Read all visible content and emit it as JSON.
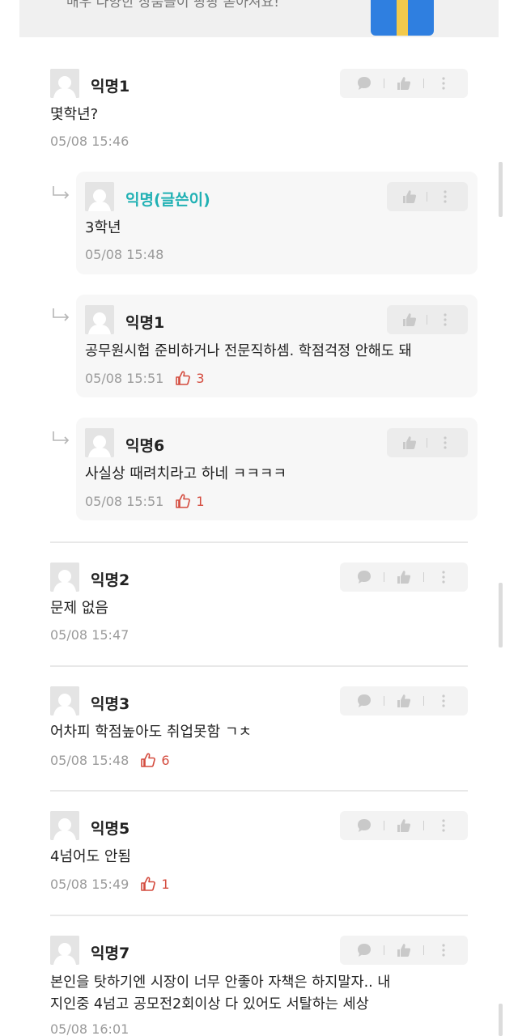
{
  "banner": {
    "text": "매우 다양한 상품들이 팡팡 쏟아져요!"
  },
  "comments": [
    {
      "author": "익명1",
      "body": "몇학년?",
      "time": "05/08 15:46",
      "likes": ""
    },
    {
      "author": "익명(글쓴이)",
      "body": "3학년",
      "time": "05/08 15:48",
      "likes": ""
    },
    {
      "author": "익명1",
      "body": "공무원시험 준비하거나 전문직하셈. 학점걱정 안해도 돼",
      "time": "05/08 15:51",
      "likes": "3"
    },
    {
      "author": "익명6",
      "body": "사실상 때려치라고 하네 ㅋㅋㅋㅋ",
      "time": "05/08 15:51",
      "likes": "1"
    },
    {
      "author": "익명2",
      "body": "문제 없음",
      "time": "05/08 15:47",
      "likes": ""
    },
    {
      "author": "익명3",
      "body": "어차피 학점높아도 취업못함 ㄱㅊ",
      "time": "05/08 15:48",
      "likes": "6"
    },
    {
      "author": "익명5",
      "body": "4넘어도 안됨",
      "time": "05/08 15:49",
      "likes": "1"
    },
    {
      "author": "익명7",
      "body_line1": "본인을 탓하기엔 시장이 너무 안좋아 자책은 하지말자.. 내",
      "body_line2": "지인중 4넘고 공모전2회이상 다 있어도 서탈하는 세상",
      "time": "05/08 16:01",
      "likes": ""
    }
  ],
  "icons": {
    "reply": "chat-bubble-icon",
    "like": "thumbs-up-icon",
    "more": "more-vertical-icon",
    "reply_arrow": "reply-arrow-icon",
    "likes_count": "thumbs-up-outline-icon"
  },
  "colors": {
    "op_author": "#21b1b4",
    "likes": "#d44b3e",
    "meta": "#9a9a9a"
  }
}
